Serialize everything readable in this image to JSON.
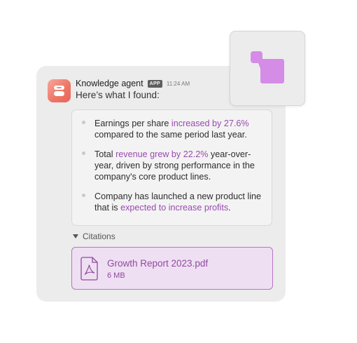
{
  "message": {
    "sender_name": "Knowledge agent",
    "badge": "APP",
    "timestamp": "11:24 AM",
    "intro": "Here’s what I found:"
  },
  "summary": {
    "points": [
      {
        "before": "Earnings per share ",
        "highlight": "increased by 27.6%",
        "after": " compared to the same period last year."
      },
      {
        "before": "Total ",
        "highlight": "revenue grew by 22.2%",
        "after": " year-over-year, driven by strong performance in the company's core product lines."
      },
      {
        "before": "Company has launched a new product line that is ",
        "highlight": "expected to increase profits",
        "after": "."
      }
    ]
  },
  "citations": {
    "label": "Citations",
    "file": {
      "name": "Growth Report 2023.pdf",
      "size": "6 MB",
      "icon": "pdf-icon"
    }
  },
  "colors": {
    "highlight": "#9a4ab0",
    "card_background": "#ececec",
    "file_card_background": "#efdff2",
    "file_card_border": "#b675c2",
    "shape_fill": "#d58ce6",
    "avatar_gradient": "#ee7766"
  }
}
